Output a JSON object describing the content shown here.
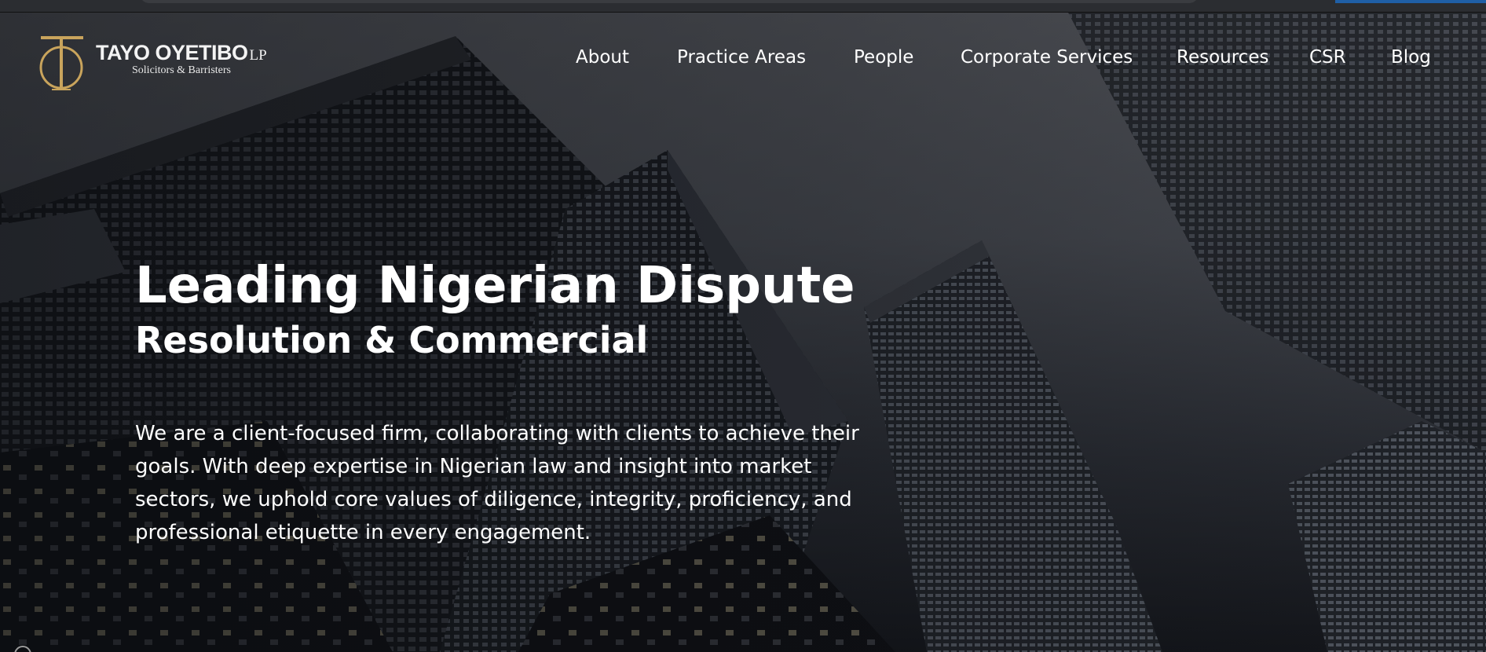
{
  "brand": {
    "name": "TAYO OYETIBO",
    "suffix": "LP",
    "tagline": "Solicitors & Barristers",
    "monogram": "TO",
    "gold": "#c9a45c"
  },
  "nav": {
    "items": [
      {
        "label": "About"
      },
      {
        "label": "Practice Areas"
      },
      {
        "label": "People"
      },
      {
        "label": "Corporate Services"
      },
      {
        "label": "Resources"
      },
      {
        "label": "CSR"
      },
      {
        "label": "Blog"
      }
    ]
  },
  "hero": {
    "title_line1": "Leading Nigerian Dispute",
    "title_line2": "Resolution & Commercial",
    "description": "We are a client-focused firm, collaborating with clients to achieve their goals. With deep expertise in Nigerian law and insight into market sectors, we uphold core values of diligence, integrity, proficiency, and professional etiquette in every engagement."
  },
  "colors": {
    "text": "#ffffff",
    "overlay": "#0a0c10"
  }
}
